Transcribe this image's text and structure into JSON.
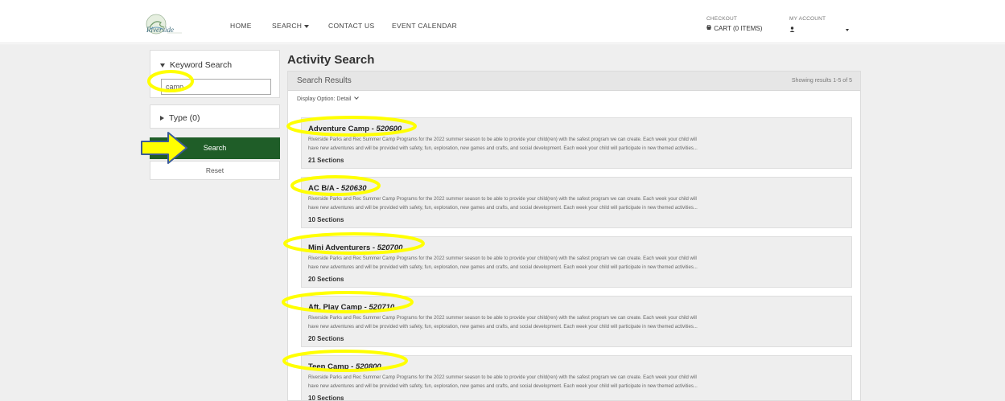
{
  "header": {
    "logo_text": "Riverside",
    "nav": [
      "HOME",
      "SEARCH",
      "CONTACT US",
      "EVENT CALENDAR"
    ],
    "checkout_label": "CHECKOUT",
    "cart_label": "CART (0 ITEMS)",
    "account_label": "MY ACCOUNT"
  },
  "sidebar": {
    "keyword_title": "Keyword Search",
    "keyword_value": "camp",
    "type_title": "Type  (0)",
    "search_label": "Search",
    "reset_label": "Reset"
  },
  "main": {
    "page_title": "Activity Search",
    "results_title": "Search Results",
    "results_count": "Showing results 1-5 of 5",
    "display_option": "Display Option:  Detail",
    "results": [
      {
        "name": "Adventure Camp",
        "code": "520600",
        "line1": "Riverside Parks and Rec Summer Camp Programs for the 2022 summer season to be able to provide your child(ren) with the safest program we can create. Each week your child will",
        "line2": "have new adventures and will be provided with safety, fun, exploration, new games and crafts, and social development. Each week your child will participate in new themed activities...",
        "sections": "21 Sections"
      },
      {
        "name": "AC B/A",
        "code": "520630",
        "line1": "Riverside Parks and Rec Summer Camp Programs for the 2022 summer season to be able to provide your child(ren) with the safest program we can create. Each week your child will",
        "line2": "have new adventures and will be provided with safety, fun, exploration, new games and crafts, and social development. Each week your child will participate in new themed activities...",
        "sections": "10 Sections"
      },
      {
        "name": "Mini Adventurers",
        "code": "520700",
        "line1": "Riverside Parks and Rec Summer Camp Programs for the 2022 summer season to be able to provide your child(ren) with the safest program we can create. Each week your child will",
        "line2": "have new adventures and will be provided with safety, fun, exploration, new games and crafts, and social development. Each week your child will participate in new themed activities...",
        "sections": "20 Sections"
      },
      {
        "name": "Aft. Play Camp",
        "code": "520710",
        "line1": "Riverside Parks and Rec Summer Camp Programs for the 2022 summer season to be able to provide your child(ren) with the safest program we can create. Each week your child will",
        "line2": "have new adventures and will be provided with safety, fun, exploration, new games and crafts, and social development. Each week your child will participate in new themed activities...",
        "sections": "20 Sections"
      },
      {
        "name": "Teen Camp",
        "code": "520800",
        "line1": "Riverside Parks and Rec Summer Camp Programs for the 2022 summer season to be able to provide your child(ren) with the safest program we can create. Each week your child will",
        "line2": "have new adventures and will be provided with safety, fun, exploration, new games and crafts, and social development. Each week your child will participate in new themed activities...",
        "sections": "10 Sections"
      }
    ]
  },
  "colors": {
    "search_button": "#1f5d28",
    "highlight_circle": "#ffff00",
    "arrow_fill": "#ffff00",
    "arrow_stroke": "#3a5a9a"
  }
}
